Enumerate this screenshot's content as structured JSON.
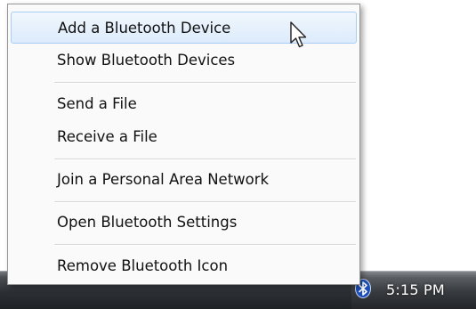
{
  "menu": {
    "items": [
      {
        "label": "Add a Bluetooth Device",
        "hovered": true
      },
      {
        "label": "Show Bluetooth Devices"
      },
      {
        "label": "Send a File"
      },
      {
        "label": "Receive a File"
      },
      {
        "label": "Join a Personal Area Network"
      },
      {
        "label": "Open Bluetooth Settings"
      },
      {
        "label": "Remove Bluetooth Icon"
      }
    ]
  },
  "taskbar": {
    "clock": "5:15 PM",
    "tray_icon": "bluetooth-icon"
  },
  "colors": {
    "hover_fill": "#dcebfb",
    "hover_border": "#a9cdf3",
    "taskbar": "#2c2f33",
    "menu_bg": "#fafafa"
  }
}
